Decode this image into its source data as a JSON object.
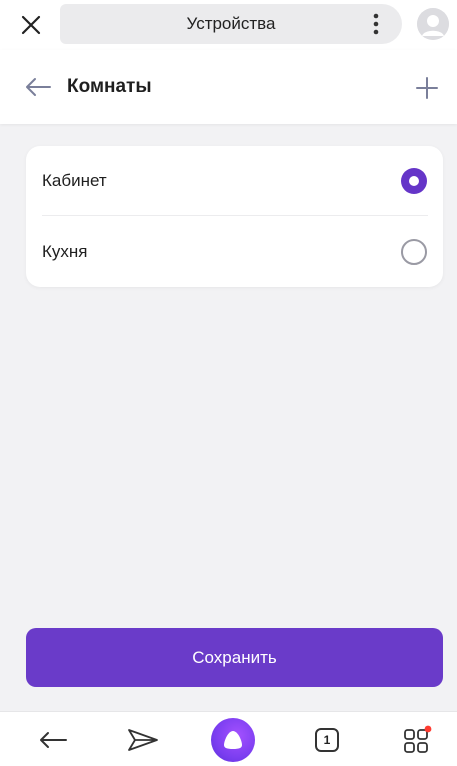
{
  "browser": {
    "address_title": "Устройства"
  },
  "header": {
    "title": "Комнаты"
  },
  "rooms": [
    {
      "label": "Кабинет",
      "selected": true
    },
    {
      "label": "Кухня",
      "selected": false
    }
  ],
  "actions": {
    "save_label": "Сохранить"
  },
  "bottom_nav": {
    "tab_count": "1"
  },
  "colors": {
    "accent": "#6a3bc9",
    "alice": "#8a3ff0",
    "notification_dot": "#ff3b30",
    "background": "#f2f2f4"
  },
  "icons": [
    "close-icon",
    "kebab-menu-icon",
    "avatar-icon",
    "back-arrow-icon",
    "plus-icon",
    "radio-checked-icon",
    "radio-unchecked-icon",
    "nav-back-icon",
    "share-icon",
    "alice-icon",
    "tabs-icon",
    "apps-grid-icon"
  ]
}
